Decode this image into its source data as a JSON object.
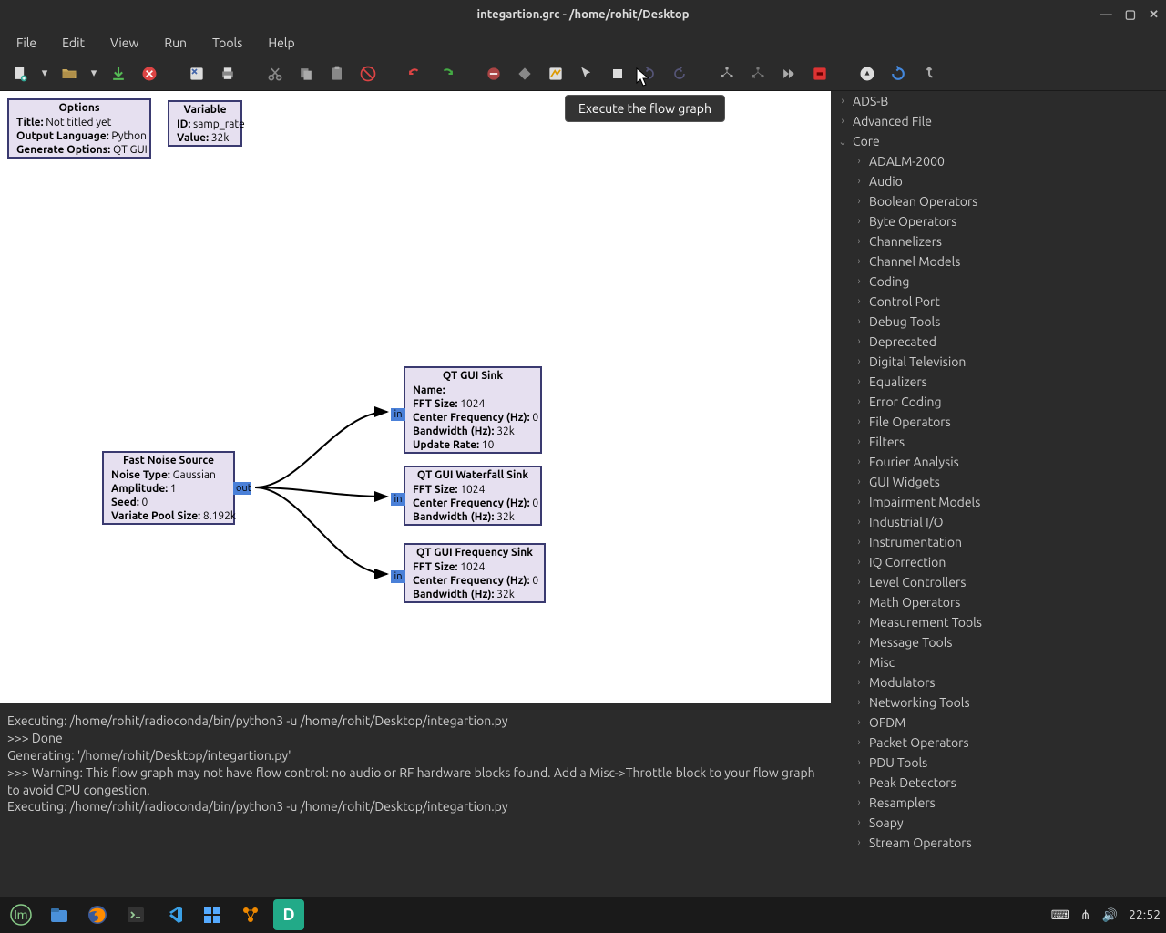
{
  "window": {
    "title": "integartion.grc - /home/rohit/Desktop"
  },
  "menubar": [
    "File",
    "Edit",
    "View",
    "Run",
    "Tools",
    "Help"
  ],
  "tooltip": "Execute the flow graph",
  "blocks": {
    "options": {
      "title": "Options",
      "rows": [
        {
          "k": "Title:",
          "v": " Not titled yet"
        },
        {
          "k": "Output Language:",
          "v": " Python"
        },
        {
          "k": "Generate Options:",
          "v": " QT GUI"
        }
      ]
    },
    "variable": {
      "title": "Variable",
      "rows": [
        {
          "k": "ID:",
          "v": " samp_rate"
        },
        {
          "k": "Value:",
          "v": " 32k"
        }
      ]
    },
    "src": {
      "title": "Fast Noise Source",
      "rows": [
        {
          "k": "Noise Type:",
          "v": " Gaussian"
        },
        {
          "k": "Amplitude:",
          "v": " 1"
        },
        {
          "k": "Seed:",
          "v": " 0"
        },
        {
          "k": "Variate Pool Size:",
          "v": " 8.192k"
        }
      ]
    },
    "sink1": {
      "title": "QT GUI Sink",
      "rows": [
        {
          "k": "Name:",
          "v": ""
        },
        {
          "k": "FFT Size:",
          "v": " 1024"
        },
        {
          "k": "Center Frequency (Hz):",
          "v": " 0"
        },
        {
          "k": "Bandwidth (Hz):",
          "v": " 32k"
        },
        {
          "k": "Update Rate:",
          "v": " 10"
        }
      ]
    },
    "sink2": {
      "title": "QT GUI Waterfall Sink",
      "rows": [
        {
          "k": "FFT Size:",
          "v": " 1024"
        },
        {
          "k": "Center Frequency (Hz):",
          "v": " 0"
        },
        {
          "k": "Bandwidth (Hz):",
          "v": " 32k"
        }
      ]
    },
    "sink3": {
      "title": "QT GUI Frequency Sink",
      "rows": [
        {
          "k": "FFT Size:",
          "v": " 1024"
        },
        {
          "k": "Center Frequency (Hz):",
          "v": " 0"
        },
        {
          "k": "Bandwidth (Hz):",
          "v": " 32k"
        }
      ]
    },
    "port_out": "out",
    "port_in": "in"
  },
  "console": {
    "lines": [
      "Executing: /home/rohit/radioconda/bin/python3 -u /home/rohit/Desktop/integartion.py",
      "",
      ">>> Done",
      "",
      "Generating: '/home/rohit/Desktop/integartion.py'",
      ">>> Warning: This flow graph may not have flow control: no audio or RF hardware blocks found. Add a Misc->Throttle block to your flow graph to avoid CPU congestion.",
      "",
      "Executing: /home/rohit/radioconda/bin/python3 -u /home/rohit/Desktop/integartion.py"
    ]
  },
  "tree": {
    "top": [
      {
        "label": "ADS-B",
        "expanded": false
      },
      {
        "label": "Advanced File",
        "expanded": false
      },
      {
        "label": "Core",
        "expanded": true
      }
    ],
    "core_children": [
      "ADALM-2000",
      "Audio",
      "Boolean Operators",
      "Byte Operators",
      "Channelizers",
      "Channel Models",
      "Coding",
      "Control Port",
      "Debug Tools",
      "Deprecated",
      "Digital Television",
      "Equalizers",
      "Error Coding",
      "File Operators",
      "Filters",
      "Fourier Analysis",
      "GUI Widgets",
      "Impairment Models",
      "Industrial I/O",
      "Instrumentation",
      "IQ Correction",
      "Level Controllers",
      "Math Operators",
      "Measurement Tools",
      "Message Tools",
      "Misc",
      "Modulators",
      "Networking Tools",
      "OFDM",
      "Packet Operators",
      "PDU Tools",
      "Peak Detectors",
      "Resamplers",
      "Soapy",
      "Stream Operators"
    ]
  },
  "taskbar": {
    "clock": "22:52"
  }
}
